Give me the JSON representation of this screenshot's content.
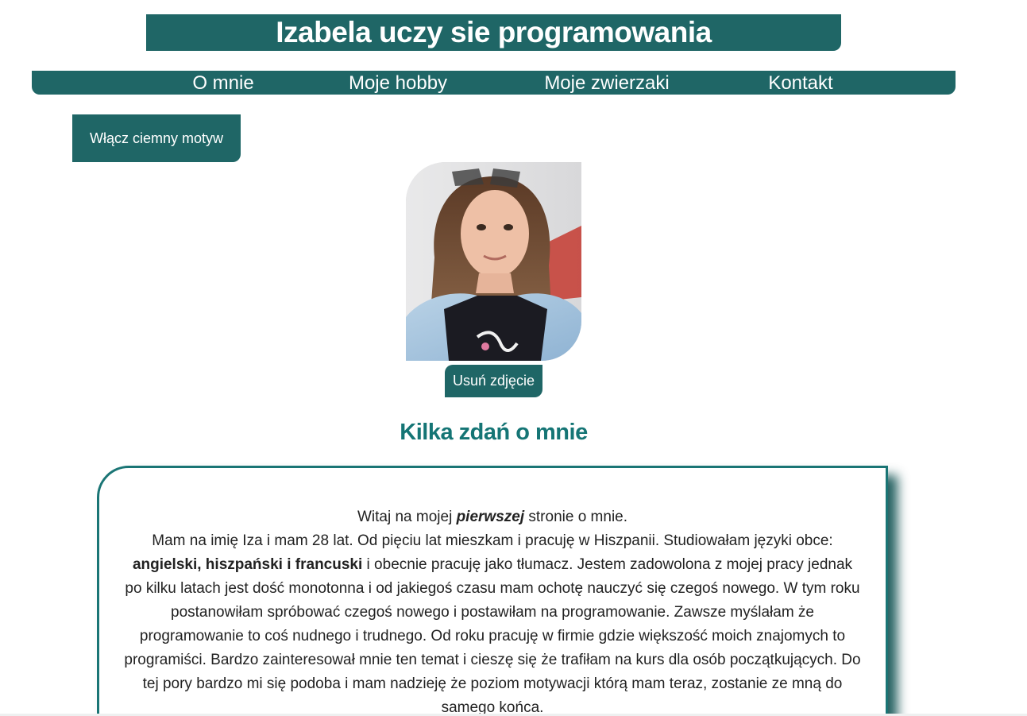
{
  "header": {
    "title": "Izabela uczy sie programowania"
  },
  "nav": {
    "items": [
      {
        "label": "O mnie"
      },
      {
        "label": "Moje hobby"
      },
      {
        "label": "Moje zwierzaki"
      },
      {
        "label": "Kontakt"
      }
    ]
  },
  "theme_button": {
    "label": "Włącz ciemny motyw"
  },
  "photo": {
    "remove_label": "Usuń zdjęcie"
  },
  "about": {
    "heading": "Kilka zdań o mnie",
    "p1_before": "Witaj na mojej ",
    "p1_emphasis": "pierwszej",
    "p1_after": " stronie o mnie.",
    "p2_intro": "Mam na imię Iza i mam 28 lat. Od pięciu lat mieszkam i pracuję w Hiszpanii. Studiowałam języki obce: ",
    "p2_languages": "angielski, hiszpański i francuski",
    "p2_rest": " i obecnie pracuję jako tłumacz. Jestem zadowolona z mojej pracy jednak po kilku latach jest dość monotonna i od jakiegoś czasu mam ochotę nauczyć się czegoś nowego. W tym roku postanowiłam spróbować czegoś nowego i postawiłam na programowanie. Zawsze myślałam że programowanie to coś nudnego i trudnego. Od roku pracuję w firmie gdzie większość moich znajomych to programiści. Bardzo zainteresował mnie ten temat i cieszę się że trafiłam na kurs dla osób początkujących. Do tej pory bardzo mi się podoba i mam nadzieję że poziom motywacji którą mam teraz, zostanie ze mną do samego końca."
  },
  "colors": {
    "primary": "#1f6666",
    "heading": "#157575",
    "border": "#1a7575"
  }
}
